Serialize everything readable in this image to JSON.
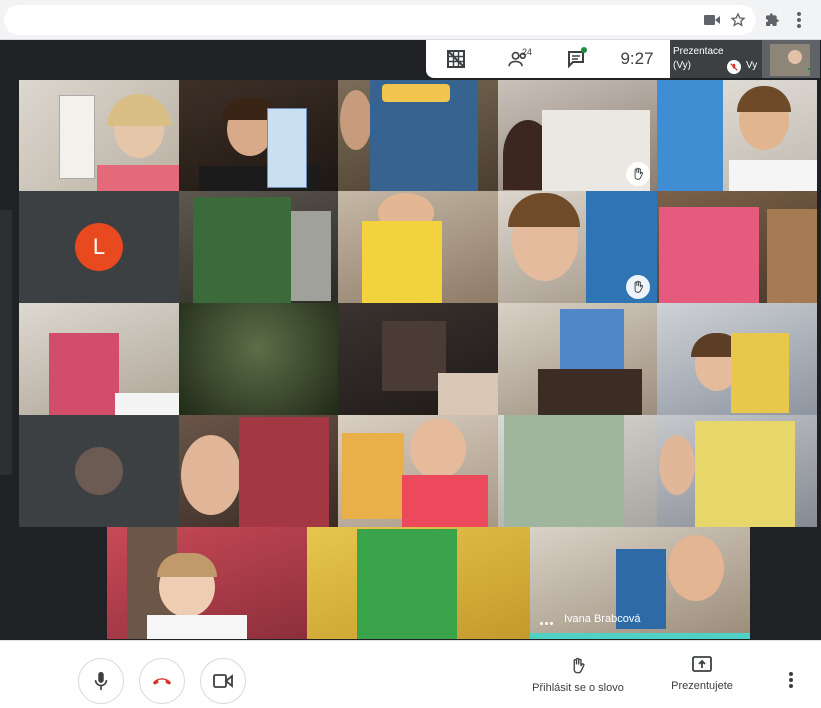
{
  "top_bar": {
    "participants_count": "24",
    "time": "9:27",
    "self_tile": {
      "line1": "Prezentace",
      "line2": "(Vy)",
      "self_label": "Vy"
    }
  },
  "grid": {
    "avatar_letter": "L",
    "avatar_color": "#e8491e",
    "name_tag": "Ivana Brabcová"
  },
  "bottom_bar": {
    "raise_hand_label": "Přihlásit se o slovo",
    "present_label": "Prezentujete"
  },
  "icons": {
    "camera": "camera-icon",
    "bookmark": "star-icon",
    "extensions": "puzzle-icon",
    "menu": "more-vert-icon",
    "hand": "raised-hand-icon"
  }
}
